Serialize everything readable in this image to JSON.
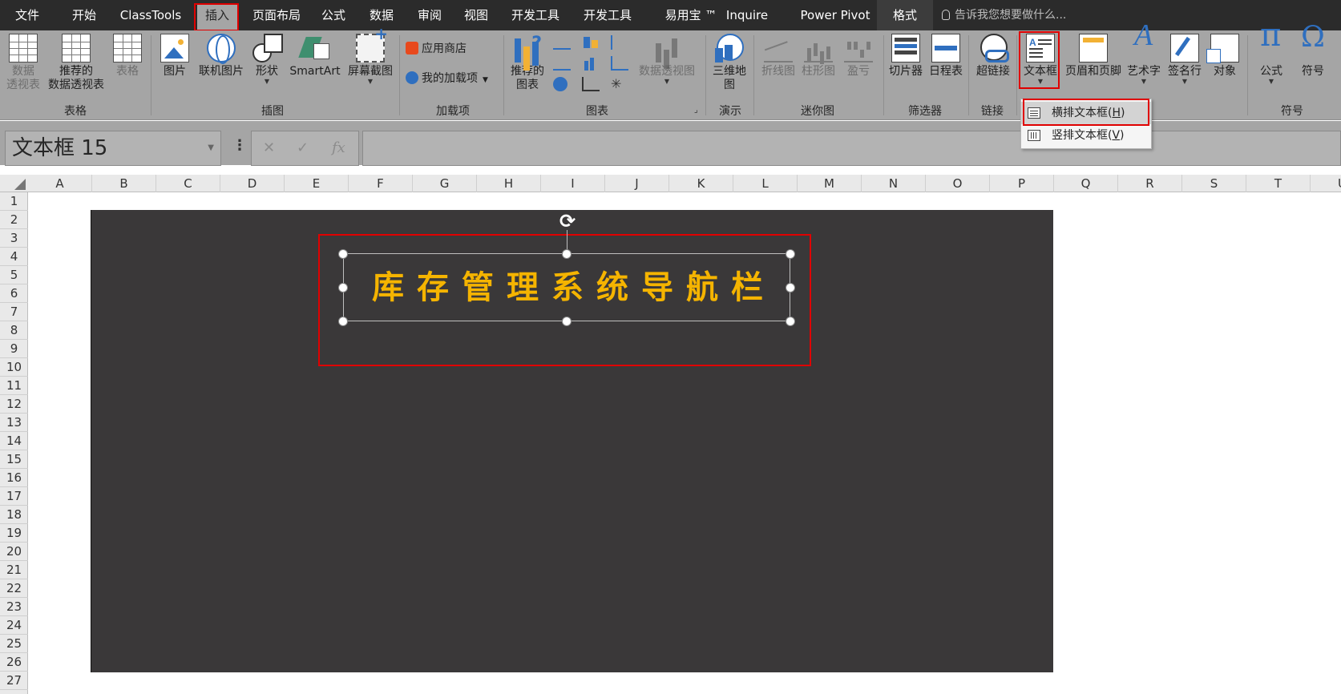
{
  "menubar": {
    "tabs": [
      {
        "label": "文件"
      },
      {
        "label": "开始"
      },
      {
        "label": "ClassTools"
      },
      {
        "label": "插入"
      },
      {
        "label": "页面布局"
      },
      {
        "label": "公式"
      },
      {
        "label": "数据"
      },
      {
        "label": "审阅"
      },
      {
        "label": "视图"
      },
      {
        "label": "开发工具"
      },
      {
        "label": "开发工具"
      },
      {
        "label": "易用宝 ™"
      },
      {
        "label": "Inquire"
      },
      {
        "label": "Power Pivot"
      },
      {
        "label": "格式"
      }
    ],
    "active_tab": "插入",
    "tell_me_placeholder": "告诉我您想要做什么..."
  },
  "ribbon": {
    "groups": {
      "tables": "表格",
      "illustrations": "插图",
      "addins": "加载项",
      "charts": "图表",
      "tours": "演示",
      "sparklines": "迷你图",
      "filters": "筛选器",
      "links": "链接",
      "symbols": "符号"
    },
    "buttons": {
      "pivot_table_1": "数据",
      "pivot_table_2": "透视表",
      "rec_pivot_1": "推荐的",
      "rec_pivot_2": "数据透视表",
      "table": "表格",
      "pictures": "图片",
      "online_pictures": "联机图片",
      "shapes": "形状",
      "smartart": "SmartArt",
      "screenshot": "屏幕截图",
      "store": "应用商店",
      "my_addins": "我的加载项",
      "rec_charts_1": "推荐的",
      "rec_charts_2": "图表",
      "pivot_chart": "数据透视图",
      "map3d_1": "三维地",
      "map3d_2": "图",
      "spark_line": "折线图",
      "spark_column": "柱形图",
      "spark_winloss": "盈亏",
      "slicer": "切片器",
      "timeline": "日程表",
      "hyperlink": "超链接",
      "textbox": "文本框",
      "header_footer": "页眉和页脚",
      "wordart": "艺术字",
      "signature": "签名行",
      "object": "对象",
      "equation": "公式",
      "symbol": "符号"
    }
  },
  "textbox_menu": {
    "horizontal_label": "横排文本框(",
    "horizontal_key": "H",
    "vertical_label": "竖排文本框(",
    "vertical_key": "V",
    "close_paren": ")"
  },
  "formula_bar": {
    "name_box": "文本框 15",
    "cancel_glyph": "✕",
    "enter_glyph": "✓",
    "fx_glyph": "fx",
    "formula": ""
  },
  "grid": {
    "columns": [
      "A",
      "B",
      "C",
      "D",
      "E",
      "F",
      "G",
      "H",
      "I",
      "J",
      "K",
      "L",
      "M",
      "N",
      "O",
      "P",
      "Q",
      "R",
      "S",
      "T",
      "U"
    ],
    "rows": [
      "1",
      "2",
      "3",
      "4",
      "5",
      "6",
      "7",
      "8",
      "9",
      "10",
      "11",
      "12",
      "13",
      "14",
      "15",
      "16",
      "17",
      "18",
      "19",
      "20",
      "21",
      "22",
      "23",
      "24",
      "25",
      "26",
      "27"
    ]
  },
  "sheet_shape": {
    "title_text": "库存管理系统导航栏",
    "title_color": "#f5b400",
    "background_color": "#3a3839"
  },
  "colors": {
    "ribbon_bg": "#a5a5a5",
    "menubar_bg": "#2b2b2b",
    "highlight_red": "#e00000"
  }
}
